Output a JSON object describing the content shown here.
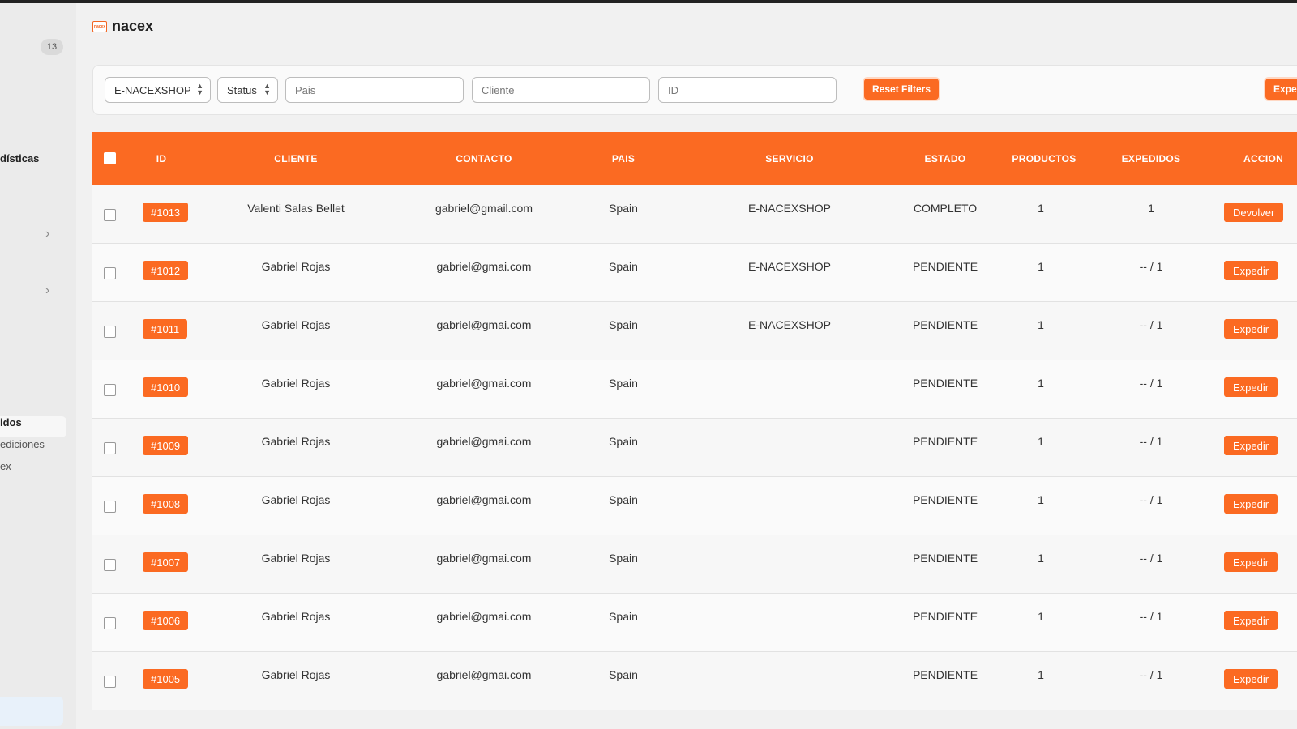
{
  "sidebar": {
    "badge": "13",
    "stats_label": "dísticas",
    "item_pedidos": "idos",
    "item_expediciones": "ediciones",
    "item_x": "ex"
  },
  "header": {
    "brand": "nacex",
    "logo_text": "nacex"
  },
  "filters": {
    "service_value": "E-NACEXSHOP",
    "status_value": "Status",
    "pais_placeholder": "Pais",
    "cliente_placeholder": "Cliente",
    "id_placeholder": "ID",
    "reset_label": "Reset Filters",
    "expedir_label": "Expe"
  },
  "table": {
    "headers": {
      "id": "ID",
      "cliente": "CLIENTE",
      "contacto": "CONTACTO",
      "pais": "PAIS",
      "servicio": "SERVICIO",
      "estado": "ESTADO",
      "productos": "PRODUCTOS",
      "expedidos": "EXPEDIDOS",
      "acciones": "ACCION"
    },
    "rows": [
      {
        "id": "#1013",
        "cliente": "Valenti Salas Bellet",
        "contacto": "gabriel@gmail.com",
        "pais": "Spain",
        "servicio": "E-NACEXSHOP",
        "estado": "COMPLETO",
        "productos": "1",
        "expedidos": "1",
        "accion": "Devolver"
      },
      {
        "id": "#1012",
        "cliente": "Gabriel Rojas",
        "contacto": "gabriel@gmai.com",
        "pais": "Spain",
        "servicio": "E-NACEXSHOP",
        "estado": "PENDIENTE",
        "productos": "1",
        "expedidos": "-- / 1",
        "accion": "Expedir"
      },
      {
        "id": "#1011",
        "cliente": "Gabriel Rojas",
        "contacto": "gabriel@gmai.com",
        "pais": "Spain",
        "servicio": "E-NACEXSHOP",
        "estado": "PENDIENTE",
        "productos": "1",
        "expedidos": "-- / 1",
        "accion": "Expedir"
      },
      {
        "id": "#1010",
        "cliente": "Gabriel Rojas",
        "contacto": "gabriel@gmai.com",
        "pais": "Spain",
        "servicio": "",
        "estado": "PENDIENTE",
        "productos": "1",
        "expedidos": "-- / 1",
        "accion": "Expedir"
      },
      {
        "id": "#1009",
        "cliente": "Gabriel Rojas",
        "contacto": "gabriel@gmai.com",
        "pais": "Spain",
        "servicio": "",
        "estado": "PENDIENTE",
        "productos": "1",
        "expedidos": "-- / 1",
        "accion": "Expedir"
      },
      {
        "id": "#1008",
        "cliente": "Gabriel Rojas",
        "contacto": "gabriel@gmai.com",
        "pais": "Spain",
        "servicio": "",
        "estado": "PENDIENTE",
        "productos": "1",
        "expedidos": "-- / 1",
        "accion": "Expedir"
      },
      {
        "id": "#1007",
        "cliente": "Gabriel Rojas",
        "contacto": "gabriel@gmai.com",
        "pais": "Spain",
        "servicio": "",
        "estado": "PENDIENTE",
        "productos": "1",
        "expedidos": "-- / 1",
        "accion": "Expedir"
      },
      {
        "id": "#1006",
        "cliente": "Gabriel Rojas",
        "contacto": "gabriel@gmai.com",
        "pais": "Spain",
        "servicio": "",
        "estado": "PENDIENTE",
        "productos": "1",
        "expedidos": "-- / 1",
        "accion": "Expedir"
      },
      {
        "id": "#1005",
        "cliente": "Gabriel Rojas",
        "contacto": "gabriel@gmai.com",
        "pais": "Spain",
        "servicio": "",
        "estado": "PENDIENTE",
        "productos": "1",
        "expedidos": "-- / 1",
        "accion": "Expedir"
      }
    ]
  },
  "colors": {
    "accent": "#fb6a22"
  }
}
